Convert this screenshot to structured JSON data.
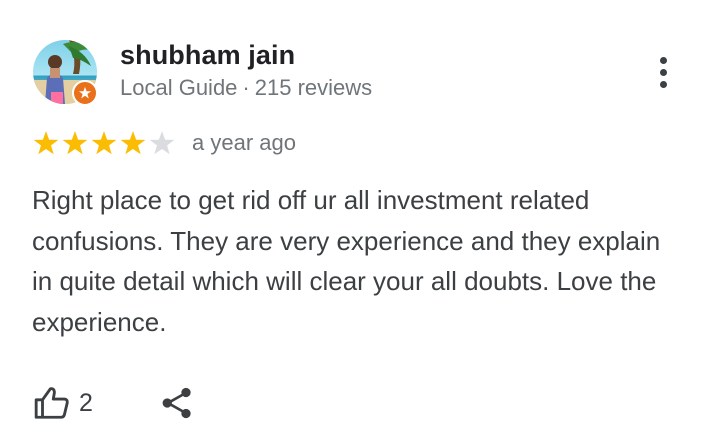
{
  "author": {
    "name": "shubham jain",
    "badge": "Local Guide",
    "separator": "·",
    "reviews_count": "215 reviews"
  },
  "rating": {
    "stars": 4,
    "max": 5,
    "date": "a year ago"
  },
  "review": {
    "text": "Right place to get rid off ur all investment related confusions. They are very experience and they explain in quite detail which will clear your all doubts. Love the experience."
  },
  "actions": {
    "like_count": "2"
  },
  "icons": {
    "more": "more-vertical-icon",
    "like": "thumbs-up-icon",
    "share": "share-icon",
    "star": "star-icon",
    "guide": "local-guide-star-icon"
  },
  "colors": {
    "star_filled": "#fbbc04",
    "star_empty": "#dadce0",
    "local_guide_badge": "#e8711a",
    "text_primary": "#202124",
    "text_secondary": "#70757a",
    "text_body": "#3c4043"
  }
}
